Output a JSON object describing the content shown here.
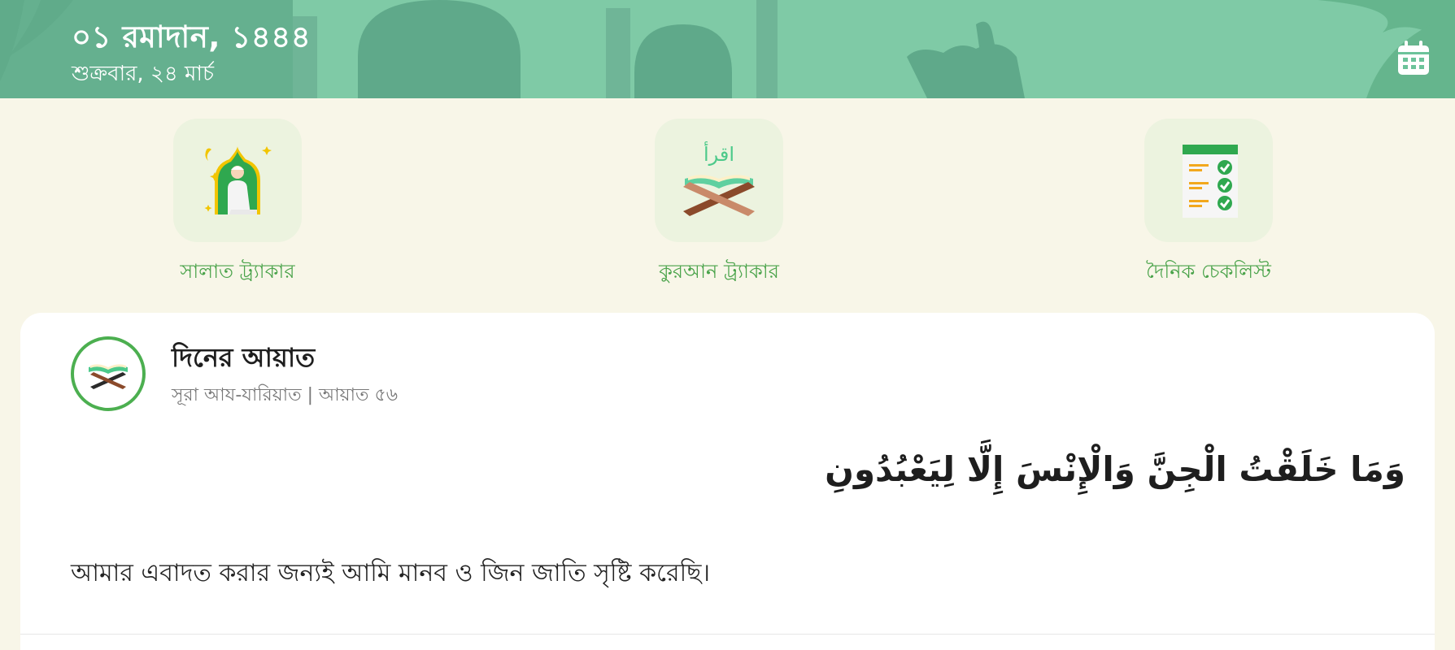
{
  "header": {
    "hijri_date": "০১ রমাদান, ১৪৪৪",
    "weekday_date": "শুক্রবার, ২৪ মার্চ",
    "calendar_icon": "calendar-icon",
    "background_color": "#6cc39a"
  },
  "tiles": [
    {
      "label": "সালাত ট্র্যাকার",
      "icon": "praying-person-icon"
    },
    {
      "label": "কুরআন ট্র্যাকার",
      "icon": "quran-stand-icon",
      "icon_text": "اقرأ"
    },
    {
      "label": "দৈনিক চেকলিস্ট",
      "icon": "checklist-icon"
    }
  ],
  "ayah": {
    "title": "দিনের আয়াত",
    "reference": "সূরা আয-যারিয়াত | আয়াত ৫৬",
    "arabic": "وَمَا خَلَقْتُ الْجِنَّ وَالْإِنْسَ إِلَّا لِيَعْبُدُونِ",
    "translation": "আমার এবাদত করার জন্যই আমি মানব ও জিন জাতি সৃষ্টি করেছি।",
    "icon": "quran-book-icon"
  },
  "colors": {
    "accent_green": "#4aa34a",
    "page_background": "#f8f6e8",
    "tile_background": "#ecf3df"
  }
}
